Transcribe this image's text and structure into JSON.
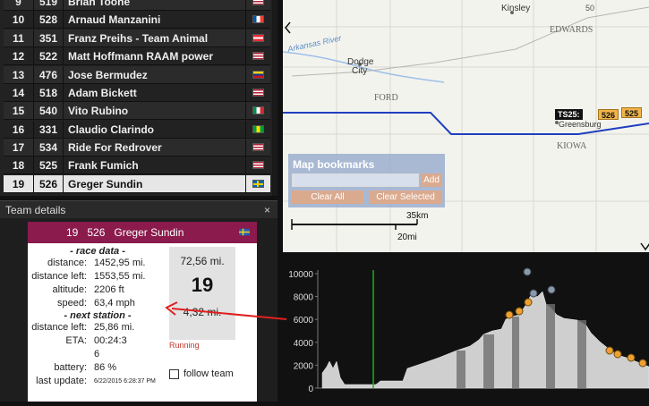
{
  "leaderboard": {
    "rows": [
      {
        "pos": "9",
        "num": "519",
        "name": "Brian Toone",
        "flag": "usa"
      },
      {
        "pos": "10",
        "num": "528",
        "name": "Arnaud Manzanini",
        "flag": "france"
      },
      {
        "pos": "11",
        "num": "351",
        "name": "Franz Preihs - Team Animal",
        "flag": "austria"
      },
      {
        "pos": "12",
        "num": "522",
        "name": "Matt Hoffmann RAAM power",
        "flag": "usa"
      },
      {
        "pos": "13",
        "num": "476",
        "name": "Jose Bermudez",
        "flag": "colombia"
      },
      {
        "pos": "14",
        "num": "518",
        "name": "Adam Bickett",
        "flag": "usa"
      },
      {
        "pos": "15",
        "num": "540",
        "name": "Vito Rubino",
        "flag": "italy"
      },
      {
        "pos": "16",
        "num": "331",
        "name": "Claudio Clarindo",
        "flag": "brazil"
      },
      {
        "pos": "17",
        "num": "534",
        "name": "Ride For Redrover",
        "flag": "usa"
      },
      {
        "pos": "18",
        "num": "525",
        "name": "Frank Fumich",
        "flag": "usa"
      },
      {
        "pos": "19",
        "num": "526",
        "name": "Greger Sundin",
        "flag": "sweden"
      }
    ]
  },
  "team_details": {
    "title": "Team details",
    "close": "×",
    "position": "19",
    "number": "526",
    "name": "Greger Sundin",
    "race_data_label": "- race data -",
    "distance_label": "distance:",
    "distance": "1452,95 mi.",
    "distance_left_label": "distance left:",
    "distance_left": "1553,55 mi.",
    "altitude_label": "altitude:",
    "altitude": "2206 ft",
    "speed_label": "speed:",
    "speed": "63,4 mph",
    "next_station_label": "- next station -",
    "ns_distance_left_label": "distance left:",
    "ns_distance_left": "25,86 mi.",
    "eta_label": "ETA:",
    "eta_line1": "00:24:3",
    "eta_line2": "6",
    "battery_label": "battery:",
    "battery": "86 %",
    "last_update_label": "last update:",
    "last_update": "6/22/2015 6:28:37 PM",
    "stat_distance": "72,56 mi.",
    "stat_position": "19",
    "stat_left": "4,32 mi.",
    "status": "Running",
    "follow_label": "follow team"
  },
  "map": {
    "places": {
      "kinsley": "Kinsley",
      "dodge_city": "Dodge\nCity",
      "ford": "FORD",
      "edwards": "EDWARDS",
      "kiowa": "KIOWA",
      "greensburg": "Greensburg",
      "river": "Arkansas River",
      "hwy": "50"
    },
    "bookmarks": {
      "title": "Map bookmarks",
      "add": "Add",
      "clear_all": "Clear All",
      "clear_selected": "Clear Selected"
    },
    "tags": {
      "ts": "TS25:",
      "t1": "526",
      "t2": "525"
    },
    "scale": {
      "km": "35km",
      "mi": "20mi"
    }
  },
  "chart_data": {
    "type": "area",
    "title": "",
    "xlabel": "",
    "ylabel": "",
    "yticks": [
      "0",
      "2000",
      "4000",
      "6000",
      "8000",
      "10000"
    ],
    "ylim": [
      0,
      11000
    ],
    "current_position_marker": true
  },
  "colors": {
    "accent": "#8b1a4d",
    "route": "#1f3fbf",
    "tag": "#f0b44a",
    "arrow": "#e02020"
  }
}
